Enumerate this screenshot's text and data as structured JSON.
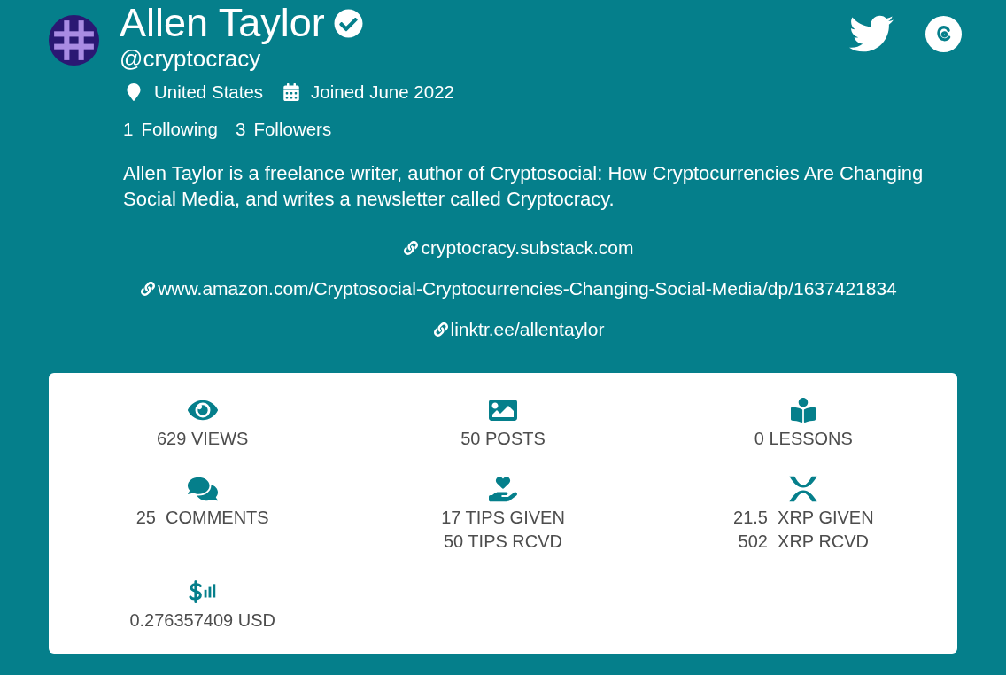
{
  "profile": {
    "name": "Allen Taylor",
    "verified": true,
    "handle": "@cryptocracy",
    "location": "United States",
    "joined": "Joined June 2022",
    "following": {
      "count": "1",
      "label": "Following"
    },
    "followers": {
      "count": "3",
      "label": "Followers"
    },
    "bio": "Allen Taylor is a freelance writer, author of Cryptosocial: How Cryptocurrencies Are Changing Social Media, and writes a newsletter called Cryptocracy.",
    "links": [
      "cryptocracy.substack.com",
      "www.amazon.com/Cryptosocial-Cryptocurrencies-Changing-Social-Media/dp/1637421834",
      "linktr.ee/allentaylor"
    ]
  },
  "social": [
    {
      "kind": "twitter"
    },
    {
      "kind": "c_logo"
    }
  ],
  "stats": [
    {
      "kind": "views",
      "lines": [
        "629 VIEWS"
      ]
    },
    {
      "kind": "posts",
      "lines": [
        "50 POSTS"
      ]
    },
    {
      "kind": "lessons",
      "lines": [
        "0 LESSONS"
      ]
    },
    {
      "kind": "comments",
      "lines": [
        "25  COMMENTS"
      ]
    },
    {
      "kind": "tips",
      "lines": [
        "17 TIPS GIVEN",
        "50 TIPS RCVD"
      ]
    },
    {
      "kind": "xrp",
      "lines": [
        "21.5  XRP GIVEN",
        "502  XRP RCVD"
      ]
    },
    {
      "kind": "usd",
      "lines": [
        "0.276357409 USD"
      ]
    }
  ]
}
